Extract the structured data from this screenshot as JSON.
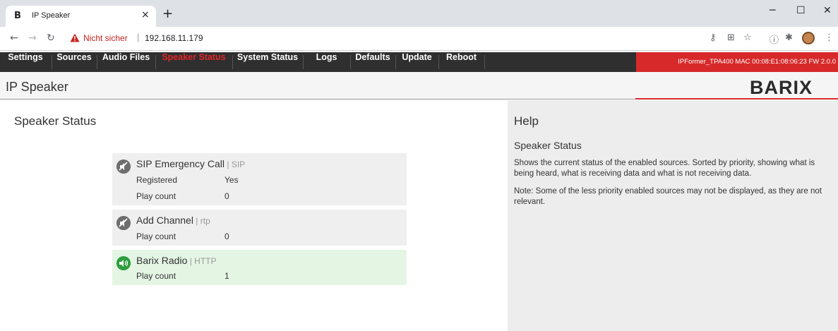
{
  "browser": {
    "tab_favicon": "B",
    "tab_title": "IP Speaker",
    "tab_close": "×",
    "new_tab": "+",
    "not_secure": "Nicht sicher",
    "url": "192.168.11.179",
    "icons": [
      "back-arrow-icon",
      "forward-arrow-icon",
      "reload-icon",
      "warning-icon",
      "key-icon",
      "translate-icon",
      "star-icon",
      "info-icon",
      "extensions-icon",
      "profile-avatar-icon",
      "more-menu-icon"
    ]
  },
  "nav": {
    "items": [
      {
        "label": "Settings"
      },
      {
        "label": "Sources"
      },
      {
        "label": "Audio Files"
      },
      {
        "label": "Speaker Status"
      },
      {
        "label": "System Status"
      },
      {
        "label": "Logs"
      },
      {
        "label": "Defaults"
      },
      {
        "label": "Update"
      },
      {
        "label": "Reboot"
      }
    ],
    "active": "Speaker Status",
    "device_info": "IPFormer_TPA400  MAC 00:08:E1:08:06:23  FW 2.0.0"
  },
  "header": {
    "title": "IP Speaker",
    "brand": "BARIX"
  },
  "main": {
    "title": "Speaker Status",
    "sources": [
      {
        "name": "SIP Emergency Call",
        "type": "SIP",
        "icon": "speaker-muted-icon",
        "rows": [
          {
            "label": "Registered",
            "value": "Yes"
          },
          {
            "label": "Play count",
            "value": "0"
          }
        ]
      },
      {
        "name": "Add Channel",
        "type": "rtp",
        "icon": "speaker-muted-icon",
        "rows": [
          {
            "label": "Play count",
            "value": "0"
          }
        ]
      },
      {
        "name": "Barix Radio",
        "type": "HTTP",
        "icon": "speaker-playing-icon",
        "rows": [
          {
            "label": "Play count",
            "value": "1"
          }
        ]
      }
    ]
  },
  "help": {
    "title": "Help",
    "subtitle": "Speaker Status",
    "paragraph1": "Shows the current status of the enabled sources. Sorted by priority, showing what is being heard, what is receiving data and what is not receiving data.",
    "paragraph2": "Note: Some of the less priority enabled sources may not be displayed, as they are not relevant."
  },
  "colors": {
    "nav_bg": "#2f2f2f",
    "accent_red": "#d7292a",
    "active_tab": "#e2262a",
    "playing_bg": "#e4f5e4",
    "playing_icon": "#2e9d3f",
    "help_bg": "#ededed"
  }
}
